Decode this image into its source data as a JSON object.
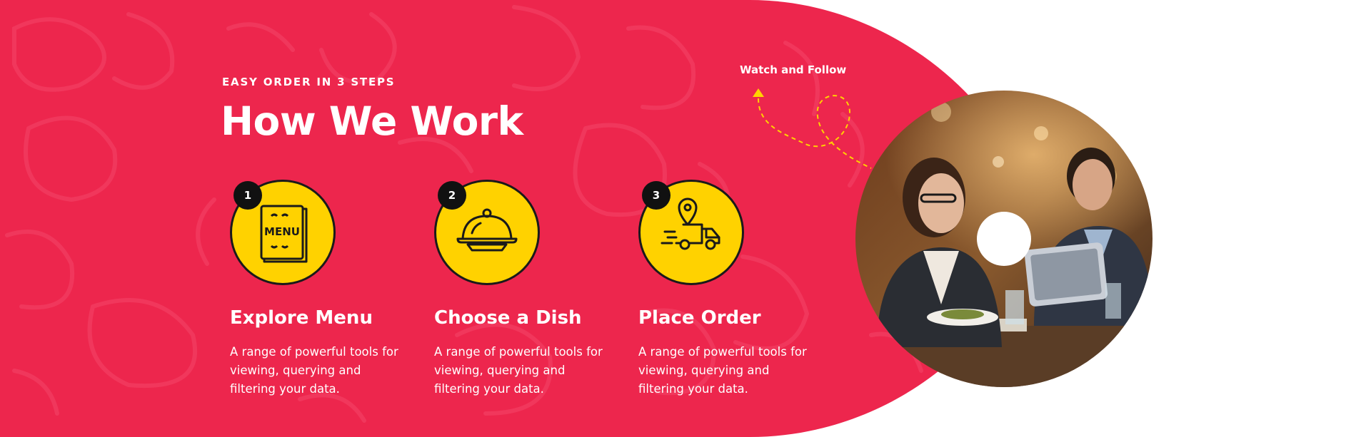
{
  "section": {
    "eyebrow": "EASY ORDER IN 3 STEPS",
    "title": "How We Work"
  },
  "steps": [
    {
      "number": "1",
      "icon": "menu-book-icon",
      "title": "Explore Menu",
      "description": "A range of powerful tools for viewing, querying and filtering your data."
    },
    {
      "number": "2",
      "icon": "food-cloche-icon",
      "title": "Choose a Dish",
      "description": "A range of powerful tools for viewing, querying and filtering your data."
    },
    {
      "number": "3",
      "icon": "delivery-truck-icon",
      "title": "Place Order",
      "description": "A range of powerful tools for viewing, querying and filtering your data."
    }
  ],
  "video": {
    "label": "Watch and Follow",
    "icon": "dashed-arrow-icon",
    "image": "restaurant-couple-photo"
  },
  "colors": {
    "brand_red": "#ed264d",
    "accent_yellow": "#ffd200",
    "dark": "#111111",
    "text_light": "#ffffff"
  },
  "menu_icon_text": "MENU"
}
